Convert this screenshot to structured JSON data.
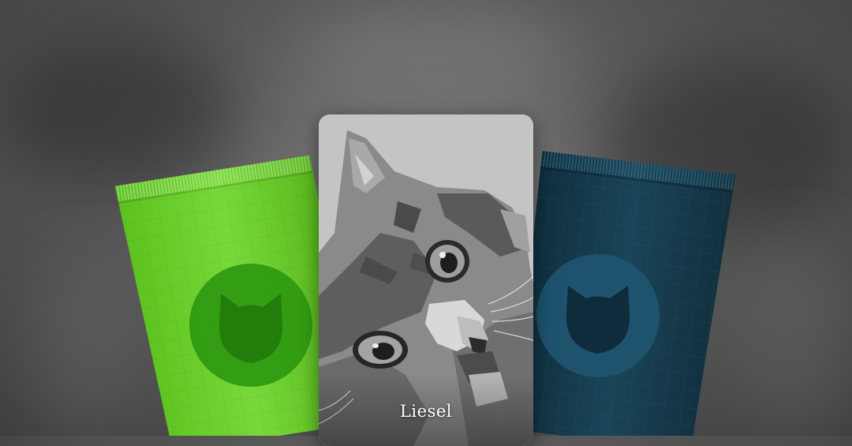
{
  "card": {
    "name": "Liesel",
    "image": "cat-portrait"
  },
  "packs": [
    {
      "name": "green-pack",
      "color": "#6ecf2f",
      "emblem": "cat-head-icon"
    },
    {
      "name": "blue-pack",
      "color": "#153a4d",
      "emblem": "cat-head-icon"
    }
  ]
}
